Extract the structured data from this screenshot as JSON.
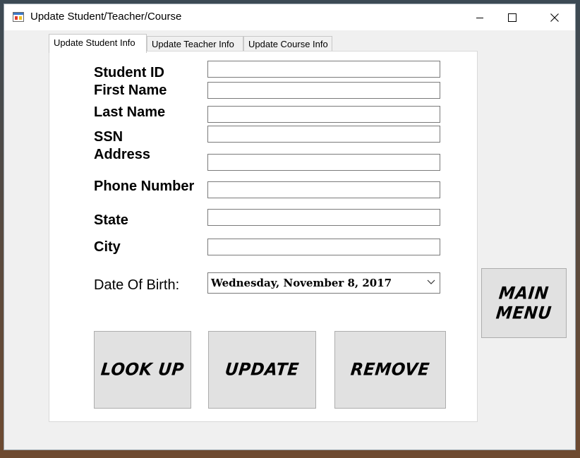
{
  "window": {
    "title": "Update Student/Teacher/Course"
  },
  "tabs": [
    {
      "label": "Update Student Info",
      "active": true
    },
    {
      "label": "Update Teacher Info",
      "active": false
    },
    {
      "label": "Update Course Info",
      "active": false
    }
  ],
  "form": {
    "student_id_label": "Student ID",
    "first_name_label": "First Name",
    "last_name_label": "Last Name",
    "ssn_label": "SSN",
    "address_label": "Address",
    "phone_label": "Phone Number",
    "state_label": "State",
    "city_label": "City",
    "dob_label": "Date Of Birth:",
    "student_id_value": "",
    "first_name_value": "",
    "last_name_value": "",
    "ssn_value": "",
    "address_value": "",
    "phone_value": "",
    "state_value": "",
    "city_value": "",
    "dob_value": "Wednesday,  November   8,  2017"
  },
  "buttons": {
    "look_up": "LOOK UP",
    "update": "UPDATE",
    "remove": "REMOVE",
    "main_menu_line1": "MAIN",
    "main_menu_line2": "MENU"
  },
  "colors": {
    "window_bg": "#f0f0f0",
    "button_bg": "#e1e1e1",
    "panel_bg": "#ffffff"
  }
}
